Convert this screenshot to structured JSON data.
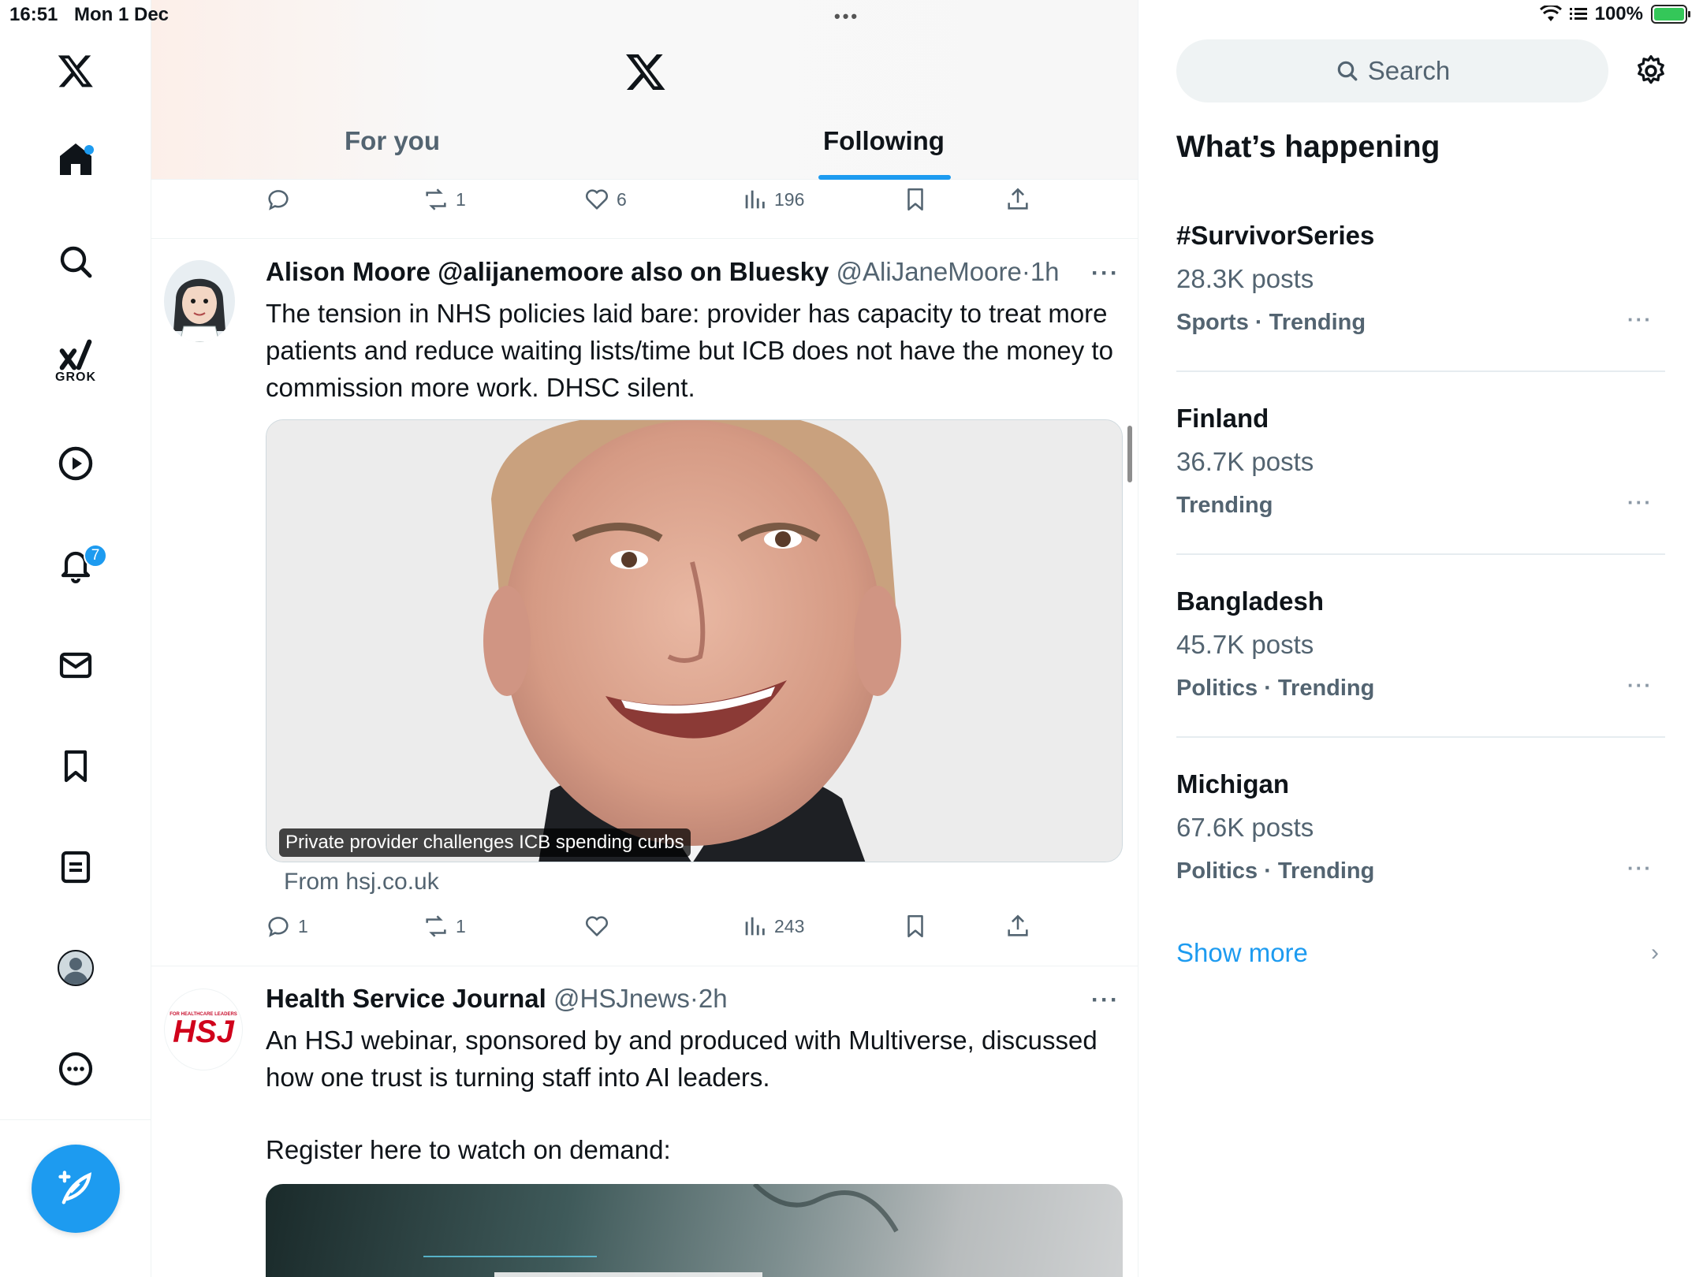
{
  "status_bar": {
    "time": "16:51",
    "date": "Mon 1 Dec",
    "battery": "100%"
  },
  "nav": {
    "notifications_badge": "7",
    "grok_label": "GROK"
  },
  "header": {
    "tabs": [
      {
        "label": "For you"
      },
      {
        "label": "Following"
      }
    ]
  },
  "prev_tweet_actions": {
    "replies": "",
    "reposts": "1",
    "likes": "6",
    "views": "196"
  },
  "tweet1": {
    "name": "Alison Moore @alijanemoore also on Bluesky",
    "handle": "@AliJaneMoore",
    "time": "1h",
    "text": "The tension in NHS policies laid bare: provider has capacity to treat more patients and reduce waiting lists/time but ICB does not have the money to commission more work. DHSC silent.",
    "media_caption": "Private provider challenges ICB spending curbs",
    "from": "From hsj.co.uk",
    "actions": {
      "replies": "1",
      "reposts": "1",
      "likes": "",
      "views": "243"
    }
  },
  "tweet2": {
    "name": "Health Service Journal",
    "handle": "@HSJnews",
    "time": "2h",
    "avatar_text": "HSJ",
    "avatar_small": "FOR HEALTHCARE LEADERS",
    "text_line1": "An HSJ webinar, sponsored by and produced with Multiverse, discussed how one trust is turning staff into AI leaders.",
    "text_line2": "Register here to watch on demand:"
  },
  "right": {
    "search_placeholder": "Search",
    "title": "What’s happening",
    "trends": [
      {
        "name": "#SurvivorSeries",
        "count": "28.3K posts",
        "meta": "Sports · Trending"
      },
      {
        "name": "Finland",
        "count": "36.7K posts",
        "meta": "Trending"
      },
      {
        "name": "Bangladesh",
        "count": "45.7K posts",
        "meta": "Politics · Trending"
      },
      {
        "name": "Michigan",
        "count": "67.6K posts",
        "meta": "Politics · Trending"
      }
    ],
    "show_more": "Show more"
  },
  "colors": {
    "accent": "#1d9bf0",
    "text": "#0f1419",
    "secondary": "#536471"
  }
}
